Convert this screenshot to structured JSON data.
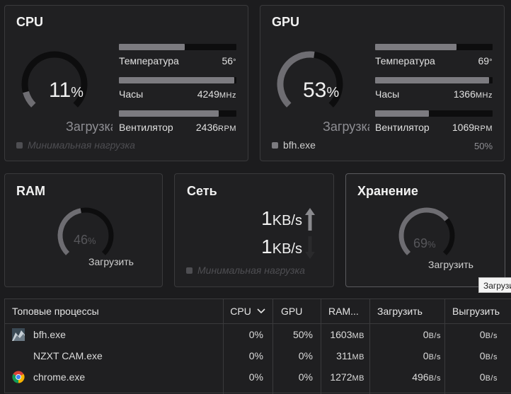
{
  "cpu": {
    "title": "CPU",
    "load_number": "11",
    "load_pct_sign": "%",
    "load_label": "Загрузка",
    "load_fraction": 0.11,
    "hint": "Минимальная нагрузка",
    "rows": [
      {
        "label": "Температура",
        "value": "56",
        "unit": "°",
        "fill": 0.56
      },
      {
        "label": "Часы",
        "value": "4249",
        "unit": "MHz",
        "fill": 0.98
      },
      {
        "label": "Вентилятор",
        "value": "2436",
        "unit": "RPM",
        "fill": 0.85
      }
    ]
  },
  "gpu": {
    "title": "GPU",
    "load_number": "53",
    "load_pct_sign": "%",
    "load_label": "Загрузка",
    "load_fraction": 0.53,
    "process": "bfh.exe",
    "process_pct": "50%",
    "rows": [
      {
        "label": "Температура",
        "value": "69",
        "unit": "°",
        "fill": 0.69
      },
      {
        "label": "Часы",
        "value": "1366",
        "unit": "MHz",
        "fill": 0.97
      },
      {
        "label": "Вентилятор",
        "value": "1069",
        "unit": "RPM",
        "fill": 0.46
      }
    ]
  },
  "ram": {
    "title": "RAM",
    "load_number": "46",
    "load_pct_sign": "%",
    "load_label": "Загрузить",
    "load_fraction": 0.46
  },
  "network": {
    "title": "Сеть",
    "upload_value": "1",
    "upload_unit": "KB/s",
    "download_value": "1",
    "download_unit": "KB/s",
    "hint": "Минимальная нагрузка"
  },
  "storage": {
    "title": "Хранение",
    "load_number": "69",
    "load_pct_sign": "%",
    "load_label": "Загрузить",
    "load_fraction": 0.69
  },
  "tooltip": "Загрузить",
  "processes": {
    "headers": {
      "name": "Топовые процессы",
      "cpu": "CPU",
      "gpu": "GPU",
      "ram": "RAM...",
      "upload": "Загрузить",
      "download": "Выгрузить"
    },
    "rows": [
      {
        "name": "bfh.exe",
        "icon": "bfh-app-icon",
        "cpu": "0%",
        "gpu": "50%",
        "ram": "1603",
        "ram_unit": "MB",
        "up": "0",
        "up_unit": "B/s",
        "down": "0",
        "down_unit": "B/s"
      },
      {
        "name": "NZXT CAM.exe",
        "icon": "",
        "cpu": "0%",
        "gpu": "0%",
        "ram": "311",
        "ram_unit": "MB",
        "up": "0",
        "up_unit": "B/s",
        "down": "0",
        "down_unit": "B/s"
      },
      {
        "name": "chrome.exe",
        "icon": "chrome-icon",
        "cpu": "0%",
        "gpu": "0%",
        "ram": "1272",
        "ram_unit": "MB",
        "up": "496",
        "up_unit": "B/s",
        "down": "0",
        "down_unit": "B/s"
      }
    ]
  },
  "colors": {
    "background": "#1c1c1e",
    "card": "#202022",
    "gauge_fill": "#6e6d72",
    "gauge_track": "#0d0d0e"
  }
}
